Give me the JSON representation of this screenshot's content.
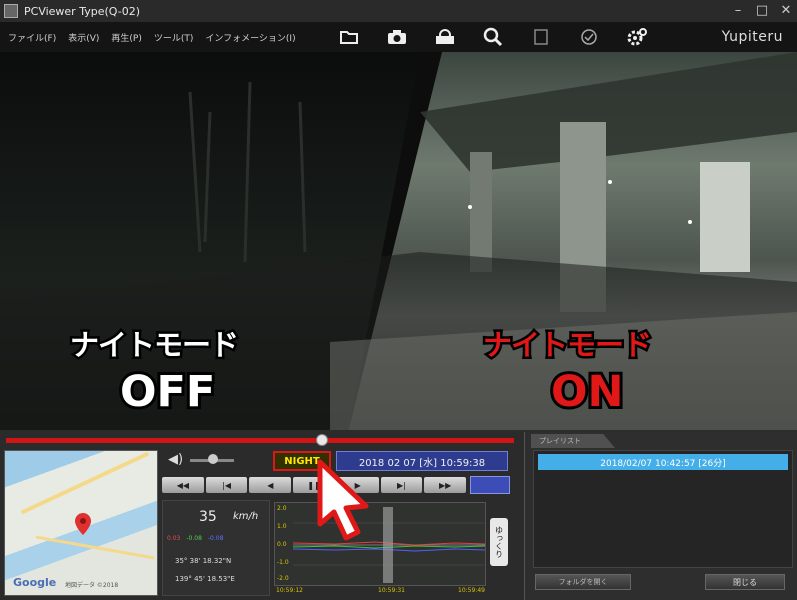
{
  "window": {
    "title": "PCViewer Type(Q-02)"
  },
  "menu": [
    "ファイル(F)",
    "表示(V)",
    "再生(P)",
    "ツール(T)",
    "インフォメーション(I)"
  ],
  "toolbar": {
    "brand": "Yupiteru"
  },
  "video": {
    "left_label": "ナイトモード",
    "left_state": "OFF",
    "right_label": "ナイトモード",
    "right_state": "ON",
    "left_color": "#ffffff",
    "right_color": "#e01818"
  },
  "player": {
    "night_button": "NIGHT",
    "datetime": "2018 02 07 [水] 10:59:38",
    "speed": "35",
    "speed_unit": "km/h",
    "gsensor": [
      "0.03",
      "-0.08",
      "-0.08"
    ],
    "latitude": "35° 38' 18.32\"N",
    "longitude": "139° 45' 18.53\"E",
    "graph_axis": [
      "2.0",
      "1.0",
      "0.0",
      "-1.0",
      "-2.0"
    ],
    "graph_times": [
      "10:59:12",
      "10:59:31",
      "10:59:49"
    ],
    "graph_scroll": "ゆっくり"
  },
  "map": {
    "logo": "Google",
    "credit": "地図データ ©2018"
  },
  "right_panel": {
    "tab": "プレイリスト",
    "selected_item": "2018/02/07 10:42:57 [26分]",
    "left_button": "フォルダを開く",
    "right_button": "閉じる"
  }
}
